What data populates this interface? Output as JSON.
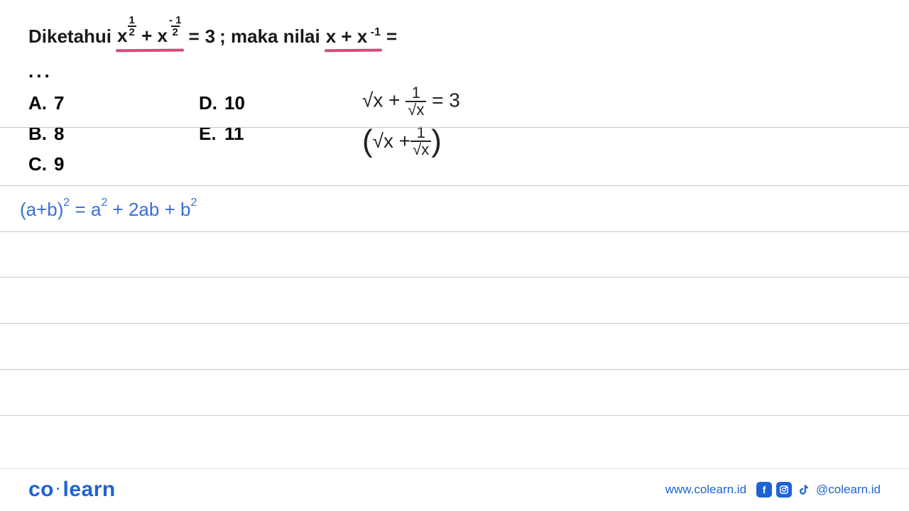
{
  "question": {
    "prefix": "Diketahui",
    "expr_given_lhs": "x^{1/2} + x^{-1/2}",
    "expr_given_rhs": "3",
    "middle_text": "; maka nilai",
    "expr_ask": "x + x^{-1}",
    "equals": "=",
    "ellipsis": "..."
  },
  "options": {
    "A": "7",
    "B": "8",
    "C": "9",
    "D": "10",
    "E": "11"
  },
  "handwriting": {
    "blue_formula": "(a+b)² = a² + 2ab + b²",
    "black_line1": "√x + 1/√x = 3",
    "black_line2": "(√x + 1/√x)"
  },
  "footer": {
    "logo_left": "co",
    "logo_right": "learn",
    "url": "www.colearn.id",
    "handle": "@colearn.id",
    "icons": {
      "facebook": "f",
      "instagram": "instagram-icon",
      "tiktok": "tiktok-icon"
    }
  },
  "colors": {
    "underline": "#d14a7a",
    "blue_pen": "#3b6dd6",
    "brand": "#1e63d6",
    "rule": "#c9c9c9"
  }
}
